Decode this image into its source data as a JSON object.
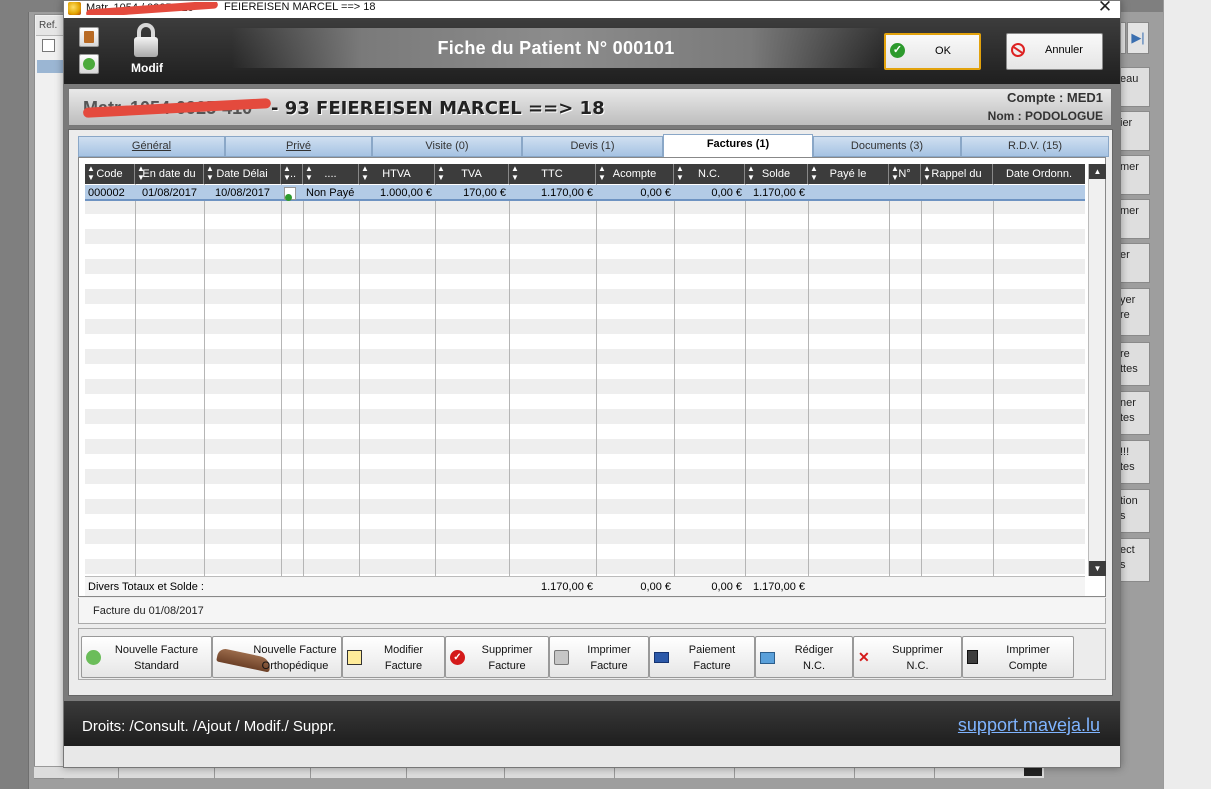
{
  "background": {
    "ref_label": "Ref.",
    "side_buttons": [
      "eau",
      "ier",
      "mer",
      "mer",
      "er",
      "yer\nre",
      "re\nttes",
      "ner\ntes",
      "!!!\ntes",
      "tion\ns",
      "ect\ns"
    ],
    "nav_icon": "last-page-icon"
  },
  "window": {
    "title_redacted": "Matr. 1054 / 0925-410",
    "title": "FEIEREISEN MARCEL ==> 18",
    "close_symbol": "✕"
  },
  "header": {
    "modif_label": "Modif",
    "title": "Fiche du Patient N° 000101",
    "ok_label": "OK",
    "cancel_label": "Annuler"
  },
  "patient": {
    "redacted_prefix": "Matr. 1054-0925-410",
    "name_line": "- 93  FEIEREISEN MARCEL ==> 18",
    "compte": "Compte :  MED1",
    "nom": "Nom : PODOLOGUE"
  },
  "tabs": [
    {
      "label": "Général",
      "active": false
    },
    {
      "label": "Privé",
      "active": false
    },
    {
      "label": "Visite (0)",
      "active": false
    },
    {
      "label": "Devis  (1)",
      "active": false
    },
    {
      "label": "Factures (1)",
      "active": true
    },
    {
      "label": "Documents (3)",
      "active": false
    },
    {
      "label": "R.D.V. (15)",
      "active": false
    }
  ],
  "grid": {
    "columns": [
      "Code",
      "En date du",
      "Date Délai",
      "...",
      "....",
      "HTVA",
      "TVA",
      "TTC",
      "Acompte",
      "N.C.",
      "Solde",
      "Payé le",
      "N°",
      "Rappel du",
      "Date Ordonn."
    ],
    "rows": [
      {
        "code": "000002",
        "date": "01/08/2017",
        "delai": "10/08/2017",
        "status": "Non Payé",
        "htva": "1.000,00 €",
        "tva": "170,00 €",
        "ttc": "1.170,00 €",
        "acompte": "0,00 €",
        "nc": "0,00 €",
        "solde": "1.170,00 €",
        "paye_le": "",
        "numero": "",
        "rappel": "",
        "ordonn": ""
      }
    ],
    "totals_label": "Divers Totaux et Solde :",
    "totals": {
      "ttc": "1.170,00 €",
      "acompte": "0,00 €",
      "nc": "0,00 €",
      "solde": "1.170,00 €"
    }
  },
  "invoice_label": "Facture du 01/08/2017",
  "actions": [
    {
      "line1": "Nouvelle Facture",
      "line2": "Standard",
      "icon": "add-green-icon"
    },
    {
      "line1": "Nouvelle Facture",
      "line2": "Orthopédique",
      "icon": "shoe-icon"
    },
    {
      "line1": "Modifier",
      "line2": "Facture",
      "icon": "edit-pen-icon"
    },
    {
      "line1": "Supprimer",
      "line2": "Facture",
      "icon": "delete-red-icon"
    },
    {
      "line1": "Imprimer",
      "line2": "Facture",
      "icon": "printer-icon"
    },
    {
      "line1": "Paiement",
      "line2": "Facture",
      "icon": "credit-card-icon"
    },
    {
      "line1": "Rédiger",
      "line2": "N.C.",
      "icon": "credit-note-icon"
    },
    {
      "line1": "Supprimer",
      "line2": "N.C.",
      "icon": "delete-x-icon"
    },
    {
      "line1": "Imprimer",
      "line2": "Compte",
      "icon": "document-icon"
    }
  ],
  "footer": {
    "rights": "Droits: /Consult. /Ajout / Modif./ Suppr.",
    "support": "support.maveja.lu"
  },
  "colors": {
    "header_dark": "#2e2e2e",
    "tab_blue": "#a6c3e3",
    "selection": "#b3cbe6",
    "ok_border": "#e2a20c",
    "link": "#7fb4ff"
  }
}
